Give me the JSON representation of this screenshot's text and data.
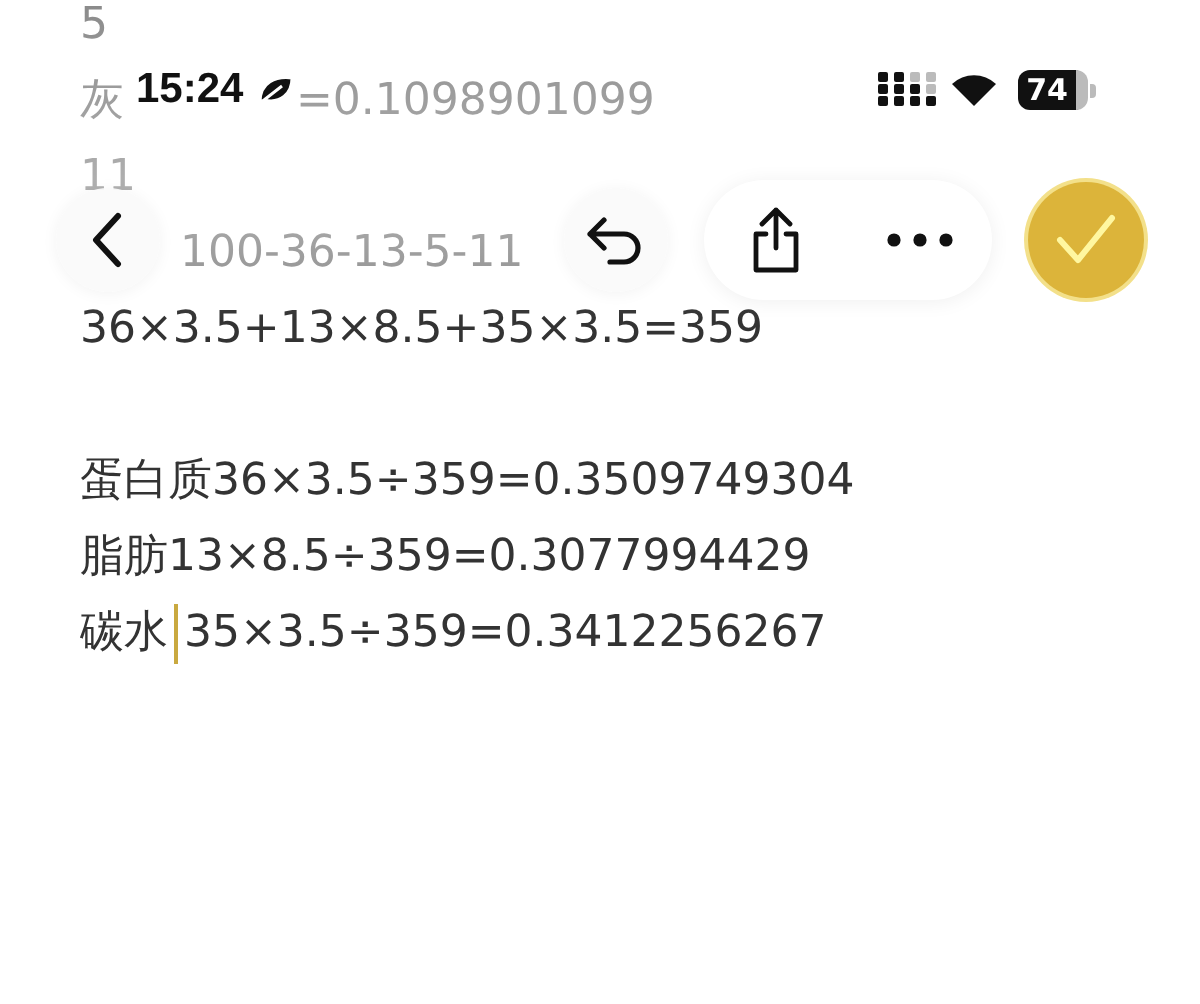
{
  "status_bar": {
    "time": "15:24",
    "battery": "74"
  },
  "toolbar": {
    "buttons": [
      {
        "kind": "back"
      },
      {
        "kind": "undo"
      },
      {
        "kind": "share"
      },
      {
        "kind": "more"
      },
      {
        "kind": "done"
      }
    ]
  },
  "note": {
    "faded_lines": [
      {
        "parts": [
          "5"
        ]
      },
      {
        "parts": [
          "灰",
          "=0.1098901099"
        ]
      },
      {
        "parts": [
          "11"
        ]
      },
      {
        "parts": [
          "100-36-13-5-11"
        ]
      }
    ],
    "lines": [
      {
        "kind": "text",
        "formula": "36×3.5+13×8.5+35×3.5=359",
        "cursor": false
      },
      {
        "kind": "blank",
        "cursor": false
      },
      {
        "label": "蛋白质",
        "formula": "36×3.5÷359=0.3509749304",
        "cursor": false
      },
      {
        "label": "脂肪",
        "formula": "13×8.5÷359=0.3077994429",
        "cursor": false
      },
      {
        "label": "碳水",
        "formula": "35×3.5÷359=0.3412256267",
        "cursor": true
      }
    ]
  }
}
